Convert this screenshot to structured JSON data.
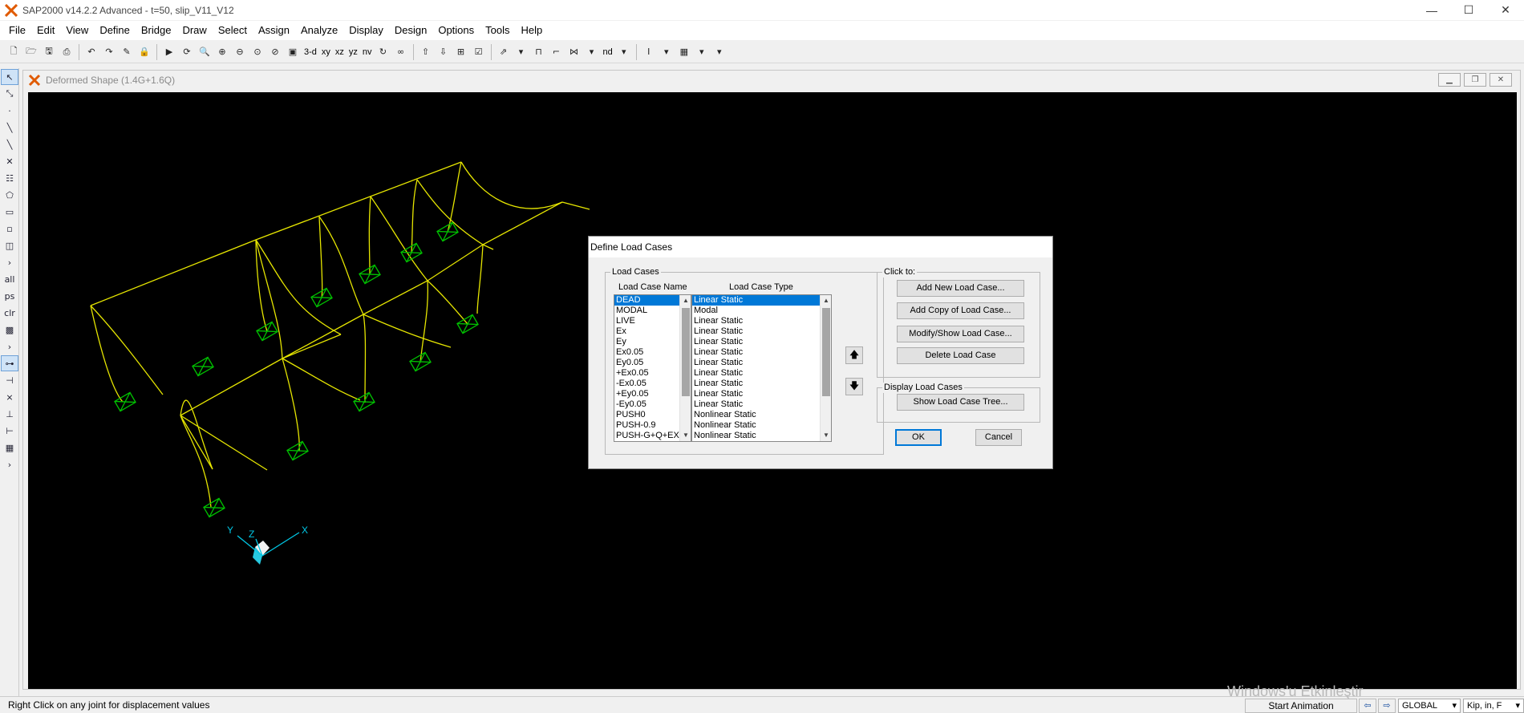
{
  "window": {
    "title": "SAP2000 v14.2.2 Advanced  - t=50, slip_V11_V12",
    "minimize_glyph": "—",
    "maximize_glyph": "☐",
    "close_glyph": "✕"
  },
  "menu": [
    "File",
    "Edit",
    "View",
    "Define",
    "Bridge",
    "Draw",
    "Select",
    "Assign",
    "Analyze",
    "Display",
    "Design",
    "Options",
    "Tools",
    "Help"
  ],
  "toolbar": {
    "view_3d": "3-d",
    "view_xy": "xy",
    "view_xz": "xz",
    "view_yz": "yz",
    "view_nv": "nv",
    "label_nd": "nd"
  },
  "left_toolbar": {
    "all": "all",
    "ps": "ps",
    "clr": "clr"
  },
  "child": {
    "title": "Deformed Shape (1.4G+1.6Q)"
  },
  "axes": {
    "x": "X",
    "y": "Y",
    "z": "Z"
  },
  "dialog": {
    "title": "Define Load Cases",
    "group_load_cases": "Load Cases",
    "col_name": "Load Case Name",
    "col_type": "Load Case Type",
    "names": [
      "DEAD",
      "MODAL",
      "LIVE",
      "Ex",
      "Ey",
      "Ex0.05",
      "Ey0.05",
      "+Ex0.05",
      "-Ex0.05",
      "+Ey0.05",
      "-Ey0.05",
      "PUSH0",
      "PUSH-0.9",
      "PUSH-G+Q+EX"
    ],
    "types": [
      "Linear Static",
      "Modal",
      "Linear Static",
      "Linear Static",
      "Linear Static",
      "Linear Static",
      "Linear Static",
      "Linear Static",
      "Linear Static",
      "Linear Static",
      "Linear Static",
      "Nonlinear Static",
      "Nonlinear Static",
      "Nonlinear Static"
    ],
    "group_click_to": "Click to:",
    "btn_add_new": "Add New Load Case...",
    "btn_add_copy": "Add Copy of Load Case...",
    "btn_modify": "Modify/Show Load Case...",
    "btn_delete": "Delete Load Case",
    "group_display": "Display Load Cases",
    "btn_show_tree": "Show Load Case Tree...",
    "btn_ok": "OK",
    "btn_cancel": "Cancel",
    "move_up_glyph": "🡅",
    "move_down_glyph": "🡇"
  },
  "status": {
    "hint": "Right Click on any joint for displacement values",
    "start_animation": "Start Animation",
    "coord_system": "GLOBAL",
    "units": "Kip, in, F",
    "watermark": "Windows'u Etkinleştir"
  },
  "colors": {
    "frame": "#e6e600",
    "support": "#00c000",
    "axes": "#00c8e6",
    "selection": "#0078d7"
  }
}
